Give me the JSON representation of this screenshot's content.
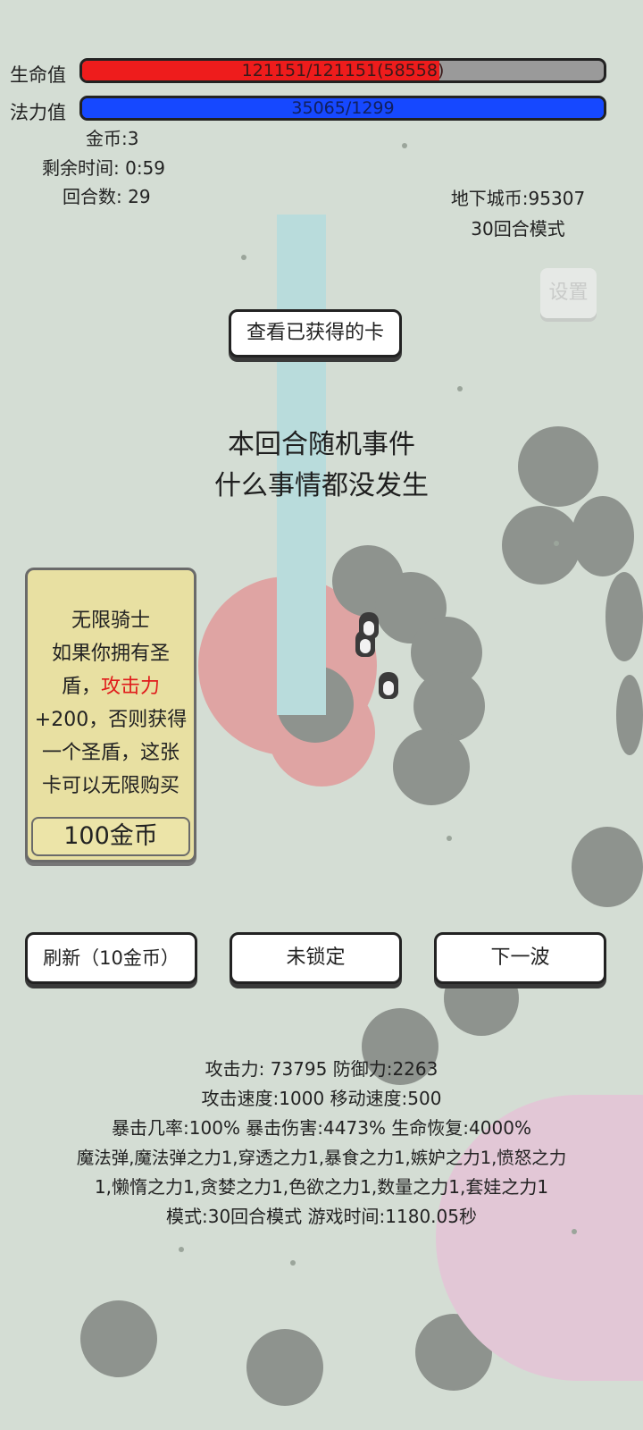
{
  "hud": {
    "hp_label": "生命值",
    "hp_text": "121151/121151(58558)",
    "hp_fill": 0.685,
    "mp_label": "法力值",
    "mp_text": "35065/1299",
    "mp_fill": 1.0,
    "gold": "金币:3",
    "time": "剩余时间: 0:59",
    "round": "回合数: 29",
    "dungeon_coin": "地下城币:95307",
    "mode": "30回合模式",
    "settings_label": "设置"
  },
  "view_cards_label": "查看已获得的卡",
  "event": {
    "title": "本回合随机事件",
    "text": "什么事情都没发生"
  },
  "card": {
    "title": "无限骑士",
    "line1": "如果你拥有圣",
    "line2_pre": "盾，",
    "line2_red": "攻击力",
    "line3": "+200，否则获得",
    "line4": "一个圣盾，这张",
    "line5": "卡可以无限购买",
    "price": "100金币"
  },
  "buttons": {
    "refresh": "刷新（10金币）",
    "lock": "未锁定",
    "next": "下一波"
  },
  "stats": {
    "line1": "攻击力: 73795 防御力:2263",
    "line2": "攻击速度:1000 移动速度:500",
    "line3": "暴击几率:100% 暴击伤害:4473% 生命恢复:4000%",
    "line4": "魔法弹,魔法弹之力1,穿透之力1,暴食之力1,嫉妒之力1,愤怒之力",
    "line5": "1,懒惰之力1,贪婪之力1,色欲之力1,数量之力1,套娃之力1",
    "line6": "模式:30回合模式 游戏时间:1180.05秒"
  },
  "colors": {
    "hp_fill": "#ee1c1c",
    "mp_fill": "#1648ff",
    "card_bg": "#e8e0a2",
    "highlight": "#e01b1b"
  }
}
